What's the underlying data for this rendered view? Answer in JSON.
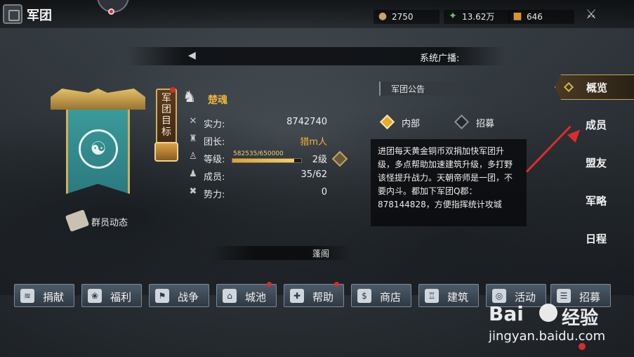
{
  "header": {
    "title": "军团",
    "resources": [
      {
        "icon": "copper-coin-icon",
        "value": "2750"
      },
      {
        "icon": "grain-icon",
        "value": "13.62万"
      },
      {
        "icon": "gold-ingot-icon",
        "value": "646"
      }
    ]
  },
  "broadcast": {
    "label": "系统广播:"
  },
  "legion": {
    "goal_tag": "军团目标",
    "name": "楚魂",
    "stats": [
      {
        "icon": "crossed-swords-icon",
        "label": "实力:",
        "value": "8742740"
      },
      {
        "icon": "helmet-icon",
        "label": "团长:",
        "value": "猎m人"
      },
      {
        "icon": "rank-icon",
        "label": "等级:",
        "value": "2级"
      },
      {
        "icon": "soldiers-icon",
        "label": "成员:",
        "value": "35/62"
      },
      {
        "icon": "power-icon",
        "label": "势力:",
        "value": "0"
      }
    ],
    "xp": {
      "text": "582535/650000",
      "fraction": 0.896
    },
    "member_dynamics": "群员动态",
    "pavilion": "蓬阁"
  },
  "announcement": {
    "header": "军团公告",
    "options": [
      {
        "label": "内部",
        "selected": true
      },
      {
        "label": "招募",
        "selected": false
      }
    ],
    "text": "进团每天黄金铜币双捐加快军团升级，多点帮助加速建筑升级，多打野该怪提升战力。天朝帝师是一团，不要内斗。都加下军团Q郡：878144828，方便指挥统计攻城"
  },
  "tabs": [
    {
      "label": "概览",
      "active": true
    },
    {
      "label": "成员",
      "active": false
    },
    {
      "label": "盟友",
      "active": false
    },
    {
      "label": "军略",
      "active": false
    },
    {
      "label": "日程",
      "active": false
    }
  ],
  "actions": [
    {
      "label": "捐献",
      "icon": "donate-icon",
      "badge": false
    },
    {
      "label": "福利",
      "icon": "welfare-icon",
      "badge": false
    },
    {
      "label": "战争",
      "icon": "war-flag-icon",
      "badge": false
    },
    {
      "label": "城池",
      "icon": "city-icon",
      "badge": true
    },
    {
      "label": "帮助",
      "icon": "help-icon",
      "badge": true
    },
    {
      "label": "商店",
      "icon": "shop-icon",
      "badge": false
    },
    {
      "label": "建筑",
      "icon": "tower-icon",
      "badge": false
    },
    {
      "label": "活动",
      "icon": "activity-icon",
      "badge": false
    },
    {
      "label": "招募",
      "icon": "recruit-icon",
      "badge": false
    }
  ],
  "watermark": {
    "brand_latin": "Bai",
    "brand_cn": "经验",
    "url": "jingyan.baidu.com"
  },
  "colors": {
    "gold": "#f0b43a",
    "accent_red": "#e02b2b",
    "teal_banner": "#2b7a7e"
  }
}
